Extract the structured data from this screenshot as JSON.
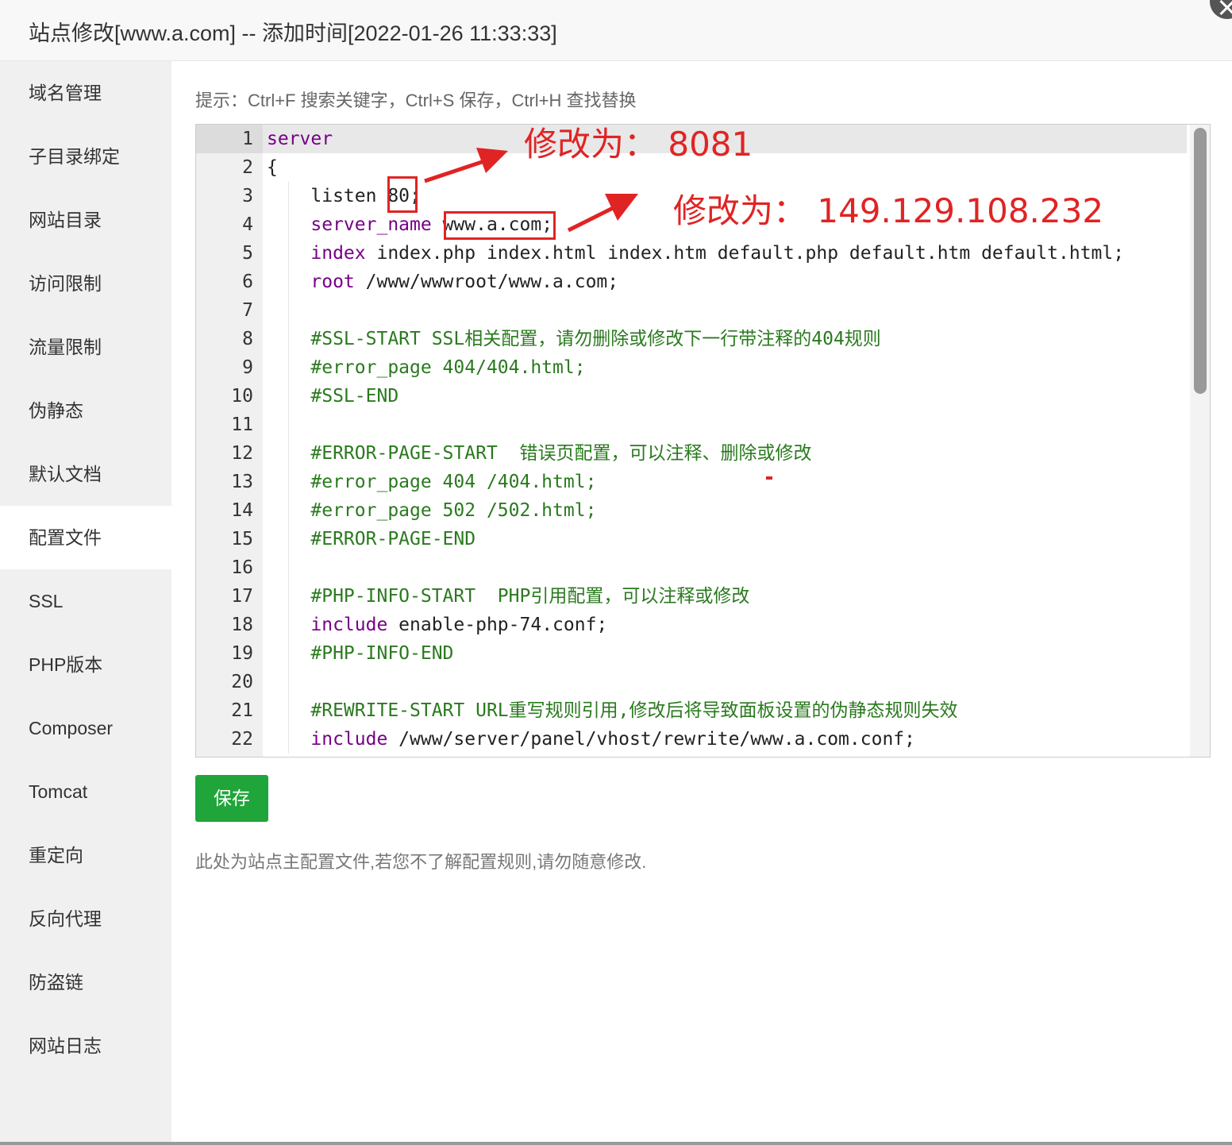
{
  "window": {
    "title": "站点修改[www.a.com] -- 添加时间[2022-01-26 11:33:33]"
  },
  "sidebar": {
    "items": [
      {
        "label": "域名管理"
      },
      {
        "label": "子目录绑定"
      },
      {
        "label": "网站目录"
      },
      {
        "label": "访问限制"
      },
      {
        "label": "流量限制"
      },
      {
        "label": "伪静态"
      },
      {
        "label": "默认文档"
      },
      {
        "label": "配置文件",
        "active": true
      },
      {
        "label": "SSL"
      },
      {
        "label": "PHP版本"
      },
      {
        "label": "Composer"
      },
      {
        "label": "Tomcat"
      },
      {
        "label": "重定向"
      },
      {
        "label": "反向代理"
      },
      {
        "label": "防盗链"
      },
      {
        "label": "网站日志"
      }
    ]
  },
  "main": {
    "hint": "提示：Ctrl+F 搜索关键字，Ctrl+S 保存，Ctrl+H 查找替换",
    "editor": {
      "lines": [
        {
          "num": "1",
          "parts": [
            {
              "t": "server",
              "c": "kw"
            }
          ]
        },
        {
          "num": "2",
          "parts": [
            {
              "t": "{",
              "c": ""
            }
          ]
        },
        {
          "num": "3",
          "parts": [
            {
              "t": "    listen ",
              "c": ""
            },
            {
              "t": "80",
              "c": ""
            },
            {
              "t": ";",
              "c": ""
            }
          ]
        },
        {
          "num": "4",
          "parts": [
            {
              "t": "    ",
              "c": ""
            },
            {
              "t": "server_name",
              "c": "kw"
            },
            {
              "t": " www.a.com;",
              "c": ""
            }
          ]
        },
        {
          "num": "5",
          "parts": [
            {
              "t": "    ",
              "c": ""
            },
            {
              "t": "index",
              "c": "kw"
            },
            {
              "t": " index.php index.html index.htm default.php default.htm default.html;",
              "c": ""
            }
          ]
        },
        {
          "num": "6",
          "parts": [
            {
              "t": "    ",
              "c": ""
            },
            {
              "t": "root",
              "c": "kw"
            },
            {
              "t": " /www/wwwroot/www.a.com;",
              "c": ""
            }
          ]
        },
        {
          "num": "7",
          "parts": []
        },
        {
          "num": "8",
          "parts": [
            {
              "t": "    #SSL-START SSL相关配置，请勿删除或修改下一行带注释的404规则",
              "c": "cm"
            }
          ]
        },
        {
          "num": "9",
          "parts": [
            {
              "t": "    #error_page 404/404.html;",
              "c": "cm"
            }
          ]
        },
        {
          "num": "10",
          "parts": [
            {
              "t": "    #SSL-END",
              "c": "cm"
            }
          ]
        },
        {
          "num": "11",
          "parts": []
        },
        {
          "num": "12",
          "parts": [
            {
              "t": "    #ERROR-PAGE-START  错误页配置，可以注释、删除或修改",
              "c": "cm"
            }
          ]
        },
        {
          "num": "13",
          "parts": [
            {
              "t": "    #error_page 404 /404.html;",
              "c": "cm"
            }
          ]
        },
        {
          "num": "14",
          "parts": [
            {
              "t": "    #error_page 502 /502.html;",
              "c": "cm"
            }
          ]
        },
        {
          "num": "15",
          "parts": [
            {
              "t": "    #ERROR-PAGE-END",
              "c": "cm"
            }
          ]
        },
        {
          "num": "16",
          "parts": []
        },
        {
          "num": "17",
          "parts": [
            {
              "t": "    #PHP-INFO-START  PHP引用配置，可以注释或修改",
              "c": "cm"
            }
          ]
        },
        {
          "num": "18",
          "parts": [
            {
              "t": "    ",
              "c": ""
            },
            {
              "t": "include",
              "c": "kw"
            },
            {
              "t": " enable-php-74.conf;",
              "c": ""
            }
          ]
        },
        {
          "num": "19",
          "parts": [
            {
              "t": "    #PHP-INFO-END",
              "c": "cm"
            }
          ]
        },
        {
          "num": "20",
          "parts": []
        },
        {
          "num": "21",
          "parts": [
            {
              "t": "    #REWRITE-START URL重写规则引用,修改后将导致面板设置的伪静态规则失效",
              "c": "cm"
            }
          ]
        },
        {
          "num": "22",
          "parts": [
            {
              "t": "    ",
              "c": ""
            },
            {
              "t": "include",
              "c": "kw"
            },
            {
              "t": " /www/server/panel/vhost/rewrite/www.a.com.conf;",
              "c": ""
            }
          ]
        }
      ]
    },
    "annotations": {
      "port": "修改为：  8081",
      "server_name": "修改为：  149.129.108.232"
    },
    "save_label": "保存",
    "note": "此处为站点主配置文件,若您不了解配置规则,请勿随意修改."
  },
  "colors": {
    "keyword": "#770088",
    "comment": "#2a7a1e",
    "save_button": "#20a53a",
    "annotation": "#e02424"
  }
}
